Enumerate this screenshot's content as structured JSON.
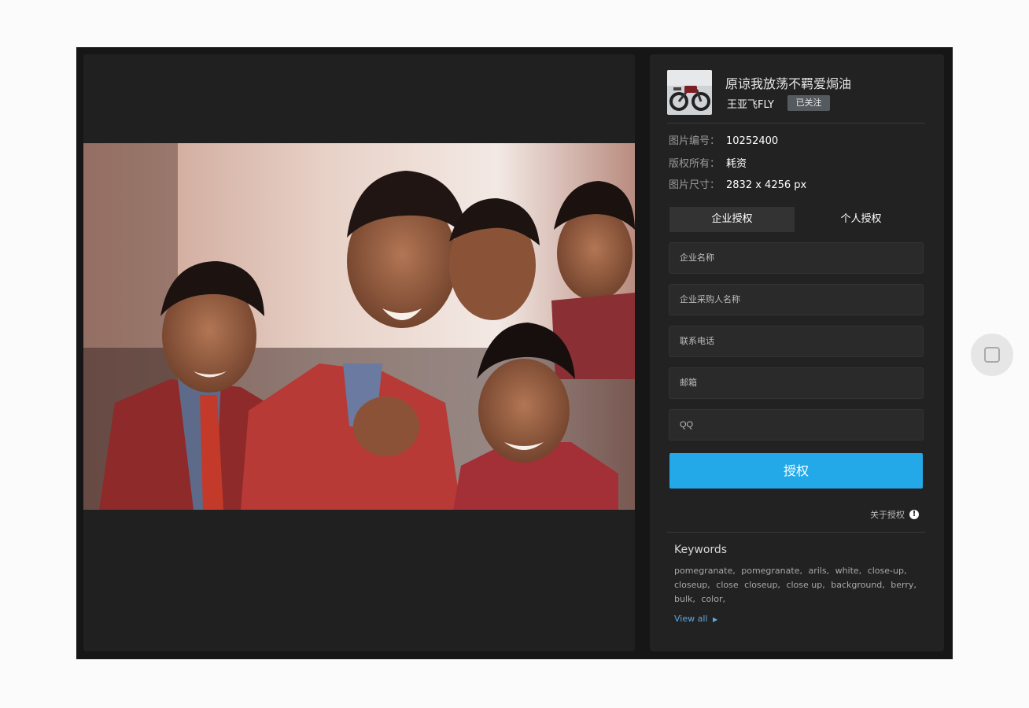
{
  "author": {
    "title": "原谅我放荡不羁爱焗油",
    "name": "王亚飞FLY",
    "follow_label": "已关注"
  },
  "meta": {
    "id_label": "图片编号：",
    "id_value": "10252400",
    "copyright_label": "版权所有：",
    "copyright_value": "耗资",
    "size_label": "图片尺寸：",
    "size_value": "2832 x 4256 px"
  },
  "tabs": {
    "enterprise": "企业授权",
    "personal": "个人授权"
  },
  "form": {
    "company_placeholder": "企业名称",
    "buyer_placeholder": "企业采购人名称",
    "phone_placeholder": "联系电话",
    "email_placeholder": "邮箱",
    "qq_placeholder": "QQ",
    "submit_label": "授权"
  },
  "about_label": "关于授权",
  "keywords": {
    "title": "Keywords",
    "items": [
      "pomegranate,",
      "pomegranate,",
      "arils,",
      "white,",
      "close-up,",
      "closeup,",
      "close",
      "closeup,",
      "close up,",
      "background,",
      "berry,",
      "bulk,",
      "color,"
    ],
    "view_all": "View all"
  },
  "colors": {
    "accent": "#24a9e8",
    "panel_bg": "#222222",
    "viewer_bg": "#202020"
  }
}
